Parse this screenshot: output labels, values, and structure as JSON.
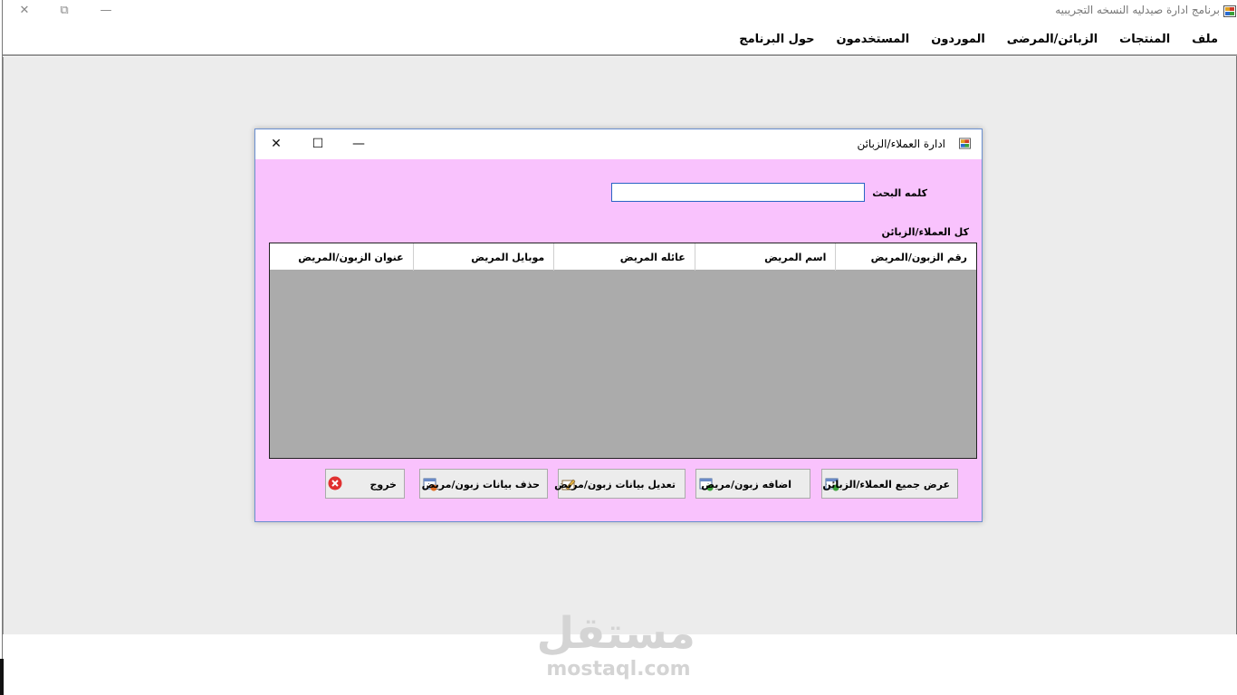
{
  "app": {
    "title": "برنامج ادارة صيدليه النسخه التجريبيه",
    "close_glyph": "✕",
    "restore_glyph": "⧉",
    "minimize_glyph": "—"
  },
  "menu": {
    "items": [
      "ملف",
      "المنتجات",
      "الزبائن/المرضى",
      "الموردون",
      "المستخدمون",
      "حول البرنامج"
    ]
  },
  "dialog": {
    "title": "ادارة العملاء/الزبائن",
    "close_glyph": "✕",
    "maximize_glyph": "☐",
    "minimize_glyph": "—",
    "search_label": "كلمه البحث",
    "search_value": "",
    "grid_label": "كل العملاء/الزبائن",
    "columns": [
      "رقم الزبون/المريض",
      "اسم المريض",
      "عائله المريض",
      "موبايل المريض",
      "عنوان الزبون/المريض"
    ],
    "buttons": {
      "show_all": "عرض جميع العملاء/الزبائن",
      "add": "اضافه زبون/مريض",
      "edit": "تعديل بيانات زبون/مريض",
      "delete": "حذف بيانات زبون/مريض",
      "exit": "خروج"
    }
  },
  "watermark": {
    "arabic": "مستقل",
    "latin": "mostaql.com"
  },
  "colors": {
    "dialog_bg": "#f9c2fd",
    "grid_bg": "#ababab",
    "mdi_bg": "#ececec",
    "exit_icon": "#e03030"
  }
}
